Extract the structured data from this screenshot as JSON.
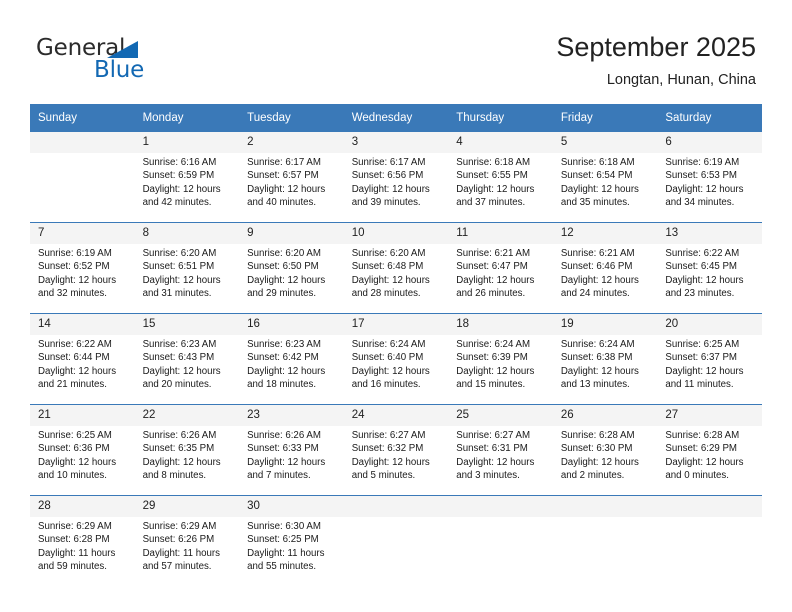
{
  "brand": {
    "name_top": "General",
    "name_bottom": "Blue",
    "accent_color": "#1268b3"
  },
  "header": {
    "title": "September 2025",
    "subtitle": "Longtan, Hunan, China"
  },
  "theme": {
    "header_row_bg": "#3a79b8",
    "daynum_bg": "#f4f4f4",
    "divider_color": "#3a79b8",
    "text_color": "#1a1a1a"
  },
  "weekday_headers": [
    "Sunday",
    "Monday",
    "Tuesday",
    "Wednesday",
    "Thursday",
    "Friday",
    "Saturday"
  ],
  "weeks": [
    [
      {
        "day": "",
        "sunrise": "",
        "sunset": "",
        "daylight_line1": "",
        "daylight_line2": ""
      },
      {
        "day": "1",
        "sunrise": "Sunrise: 6:16 AM",
        "sunset": "Sunset: 6:59 PM",
        "daylight_line1": "Daylight: 12 hours",
        "daylight_line2": "and 42 minutes."
      },
      {
        "day": "2",
        "sunrise": "Sunrise: 6:17 AM",
        "sunset": "Sunset: 6:57 PM",
        "daylight_line1": "Daylight: 12 hours",
        "daylight_line2": "and 40 minutes."
      },
      {
        "day": "3",
        "sunrise": "Sunrise: 6:17 AM",
        "sunset": "Sunset: 6:56 PM",
        "daylight_line1": "Daylight: 12 hours",
        "daylight_line2": "and 39 minutes."
      },
      {
        "day": "4",
        "sunrise": "Sunrise: 6:18 AM",
        "sunset": "Sunset: 6:55 PM",
        "daylight_line1": "Daylight: 12 hours",
        "daylight_line2": "and 37 minutes."
      },
      {
        "day": "5",
        "sunrise": "Sunrise: 6:18 AM",
        "sunset": "Sunset: 6:54 PM",
        "daylight_line1": "Daylight: 12 hours",
        "daylight_line2": "and 35 minutes."
      },
      {
        "day": "6",
        "sunrise": "Sunrise: 6:19 AM",
        "sunset": "Sunset: 6:53 PM",
        "daylight_line1": "Daylight: 12 hours",
        "daylight_line2": "and 34 minutes."
      }
    ],
    [
      {
        "day": "7",
        "sunrise": "Sunrise: 6:19 AM",
        "sunset": "Sunset: 6:52 PM",
        "daylight_line1": "Daylight: 12 hours",
        "daylight_line2": "and 32 minutes."
      },
      {
        "day": "8",
        "sunrise": "Sunrise: 6:20 AM",
        "sunset": "Sunset: 6:51 PM",
        "daylight_line1": "Daylight: 12 hours",
        "daylight_line2": "and 31 minutes."
      },
      {
        "day": "9",
        "sunrise": "Sunrise: 6:20 AM",
        "sunset": "Sunset: 6:50 PM",
        "daylight_line1": "Daylight: 12 hours",
        "daylight_line2": "and 29 minutes."
      },
      {
        "day": "10",
        "sunrise": "Sunrise: 6:20 AM",
        "sunset": "Sunset: 6:48 PM",
        "daylight_line1": "Daylight: 12 hours",
        "daylight_line2": "and 28 minutes."
      },
      {
        "day": "11",
        "sunrise": "Sunrise: 6:21 AM",
        "sunset": "Sunset: 6:47 PM",
        "daylight_line1": "Daylight: 12 hours",
        "daylight_line2": "and 26 minutes."
      },
      {
        "day": "12",
        "sunrise": "Sunrise: 6:21 AM",
        "sunset": "Sunset: 6:46 PM",
        "daylight_line1": "Daylight: 12 hours",
        "daylight_line2": "and 24 minutes."
      },
      {
        "day": "13",
        "sunrise": "Sunrise: 6:22 AM",
        "sunset": "Sunset: 6:45 PM",
        "daylight_line1": "Daylight: 12 hours",
        "daylight_line2": "and 23 minutes."
      }
    ],
    [
      {
        "day": "14",
        "sunrise": "Sunrise: 6:22 AM",
        "sunset": "Sunset: 6:44 PM",
        "daylight_line1": "Daylight: 12 hours",
        "daylight_line2": "and 21 minutes."
      },
      {
        "day": "15",
        "sunrise": "Sunrise: 6:23 AM",
        "sunset": "Sunset: 6:43 PM",
        "daylight_line1": "Daylight: 12 hours",
        "daylight_line2": "and 20 minutes."
      },
      {
        "day": "16",
        "sunrise": "Sunrise: 6:23 AM",
        "sunset": "Sunset: 6:42 PM",
        "daylight_line1": "Daylight: 12 hours",
        "daylight_line2": "and 18 minutes."
      },
      {
        "day": "17",
        "sunrise": "Sunrise: 6:24 AM",
        "sunset": "Sunset: 6:40 PM",
        "daylight_line1": "Daylight: 12 hours",
        "daylight_line2": "and 16 minutes."
      },
      {
        "day": "18",
        "sunrise": "Sunrise: 6:24 AM",
        "sunset": "Sunset: 6:39 PM",
        "daylight_line1": "Daylight: 12 hours",
        "daylight_line2": "and 15 minutes."
      },
      {
        "day": "19",
        "sunrise": "Sunrise: 6:24 AM",
        "sunset": "Sunset: 6:38 PM",
        "daylight_line1": "Daylight: 12 hours",
        "daylight_line2": "and 13 minutes."
      },
      {
        "day": "20",
        "sunrise": "Sunrise: 6:25 AM",
        "sunset": "Sunset: 6:37 PM",
        "daylight_line1": "Daylight: 12 hours",
        "daylight_line2": "and 11 minutes."
      }
    ],
    [
      {
        "day": "21",
        "sunrise": "Sunrise: 6:25 AM",
        "sunset": "Sunset: 6:36 PM",
        "daylight_line1": "Daylight: 12 hours",
        "daylight_line2": "and 10 minutes."
      },
      {
        "day": "22",
        "sunrise": "Sunrise: 6:26 AM",
        "sunset": "Sunset: 6:35 PM",
        "daylight_line1": "Daylight: 12 hours",
        "daylight_line2": "and 8 minutes."
      },
      {
        "day": "23",
        "sunrise": "Sunrise: 6:26 AM",
        "sunset": "Sunset: 6:33 PM",
        "daylight_line1": "Daylight: 12 hours",
        "daylight_line2": "and 7 minutes."
      },
      {
        "day": "24",
        "sunrise": "Sunrise: 6:27 AM",
        "sunset": "Sunset: 6:32 PM",
        "daylight_line1": "Daylight: 12 hours",
        "daylight_line2": "and 5 minutes."
      },
      {
        "day": "25",
        "sunrise": "Sunrise: 6:27 AM",
        "sunset": "Sunset: 6:31 PM",
        "daylight_line1": "Daylight: 12 hours",
        "daylight_line2": "and 3 minutes."
      },
      {
        "day": "26",
        "sunrise": "Sunrise: 6:28 AM",
        "sunset": "Sunset: 6:30 PM",
        "daylight_line1": "Daylight: 12 hours",
        "daylight_line2": "and 2 minutes."
      },
      {
        "day": "27",
        "sunrise": "Sunrise: 6:28 AM",
        "sunset": "Sunset: 6:29 PM",
        "daylight_line1": "Daylight: 12 hours",
        "daylight_line2": "and 0 minutes."
      }
    ],
    [
      {
        "day": "28",
        "sunrise": "Sunrise: 6:29 AM",
        "sunset": "Sunset: 6:28 PM",
        "daylight_line1": "Daylight: 11 hours",
        "daylight_line2": "and 59 minutes."
      },
      {
        "day": "29",
        "sunrise": "Sunrise: 6:29 AM",
        "sunset": "Sunset: 6:26 PM",
        "daylight_line1": "Daylight: 11 hours",
        "daylight_line2": "and 57 minutes."
      },
      {
        "day": "30",
        "sunrise": "Sunrise: 6:30 AM",
        "sunset": "Sunset: 6:25 PM",
        "daylight_line1": "Daylight: 11 hours",
        "daylight_line2": "and 55 minutes."
      },
      {
        "day": "",
        "sunrise": "",
        "sunset": "",
        "daylight_line1": "",
        "daylight_line2": ""
      },
      {
        "day": "",
        "sunrise": "",
        "sunset": "",
        "daylight_line1": "",
        "daylight_line2": ""
      },
      {
        "day": "",
        "sunrise": "",
        "sunset": "",
        "daylight_line1": "",
        "daylight_line2": ""
      },
      {
        "day": "",
        "sunrise": "",
        "sunset": "",
        "daylight_line1": "",
        "daylight_line2": ""
      }
    ]
  ]
}
